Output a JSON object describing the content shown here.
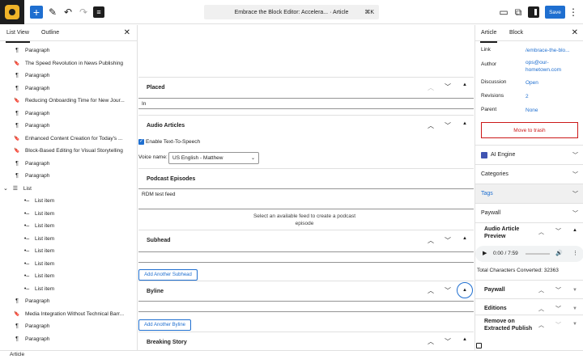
{
  "topbar": {
    "doc_title": "Embrace the Block Editor: Accelera... · Article",
    "shortcut": "⌘K",
    "save_label": "Save"
  },
  "left": {
    "tabs": [
      "List View",
      "Outline"
    ],
    "items": [
      {
        "icon": "¶",
        "label": "Paragraph"
      },
      {
        "icon": "🔖",
        "label": "The Speed Revolution in News Publishing"
      },
      {
        "icon": "¶",
        "label": "Paragraph"
      },
      {
        "icon": "¶",
        "label": "Paragraph"
      },
      {
        "icon": "🔖",
        "label": "Reducing Onboarding Time for New Jour..."
      },
      {
        "icon": "¶",
        "label": "Paragraph"
      },
      {
        "icon": "¶",
        "label": "Paragraph"
      },
      {
        "icon": "🔖",
        "label": "Enhanced Content Creation for Today's ..."
      },
      {
        "icon": "🔖",
        "label": "Block-Based Editing for Visual Storytelling"
      },
      {
        "icon": "¶",
        "label": "Paragraph"
      },
      {
        "icon": "¶",
        "label": "Paragraph"
      },
      {
        "icon": "☰",
        "label": "List"
      },
      {
        "icon": "•–",
        "label": "List item"
      },
      {
        "icon": "•–",
        "label": "List item"
      },
      {
        "icon": "•–",
        "label": "List item"
      },
      {
        "icon": "•–",
        "label": "List item"
      },
      {
        "icon": "•–",
        "label": "List item"
      },
      {
        "icon": "•–",
        "label": "List item"
      },
      {
        "icon": "•–",
        "label": "List item"
      },
      {
        "icon": "•–",
        "label": "List item"
      },
      {
        "icon": "¶",
        "label": "Paragraph"
      },
      {
        "icon": "🔖",
        "label": "Media Integration Without Technical Barr..."
      },
      {
        "icon": "¶",
        "label": "Paragraph"
      },
      {
        "icon": "¶",
        "label": "Paragraph"
      }
    ]
  },
  "center": {
    "placed": {
      "title": "Placed",
      "value": "In"
    },
    "audio": {
      "title": "Audio Articles",
      "checkbox_label": "Enable Text-To-Speech",
      "voice_label": "Voice name:",
      "voice_value": "US English - Matthew"
    },
    "podcast": {
      "title": "Podcast Episodes",
      "feed_value": "RDM test feed",
      "hint": "Select an available feed to create a podcast episode"
    },
    "subhead": {
      "title": "Subhead",
      "button": "Add Another Subhead"
    },
    "byline": {
      "title": "Byline",
      "button": "Add Another Byline"
    },
    "breaking": {
      "title": "Breaking Story"
    }
  },
  "right": {
    "tabs": [
      "Article",
      "Block"
    ],
    "link": "/embrace-the-blo...",
    "author": "ops@our-hometown.com",
    "discussion": "Open",
    "revisions": "2",
    "parent": "None",
    "labels": {
      "link": "Link",
      "author": "Author",
      "discussion": "Discussion",
      "revisions": "Revisions",
      "parent": "Parent"
    },
    "trash": "Move to trash",
    "panels": [
      "AI Engine",
      "Categories",
      "Tags",
      "Paywall"
    ],
    "audio_preview": {
      "title": "Audio Article Preview",
      "time": "0:00 / 7:59",
      "chars": "Total Characters Converted: 32363"
    },
    "lower_panels": [
      "Paywall",
      "Editions",
      "Remove on Extracted Publish"
    ]
  },
  "status": {
    "breadcrumb": "Article"
  }
}
